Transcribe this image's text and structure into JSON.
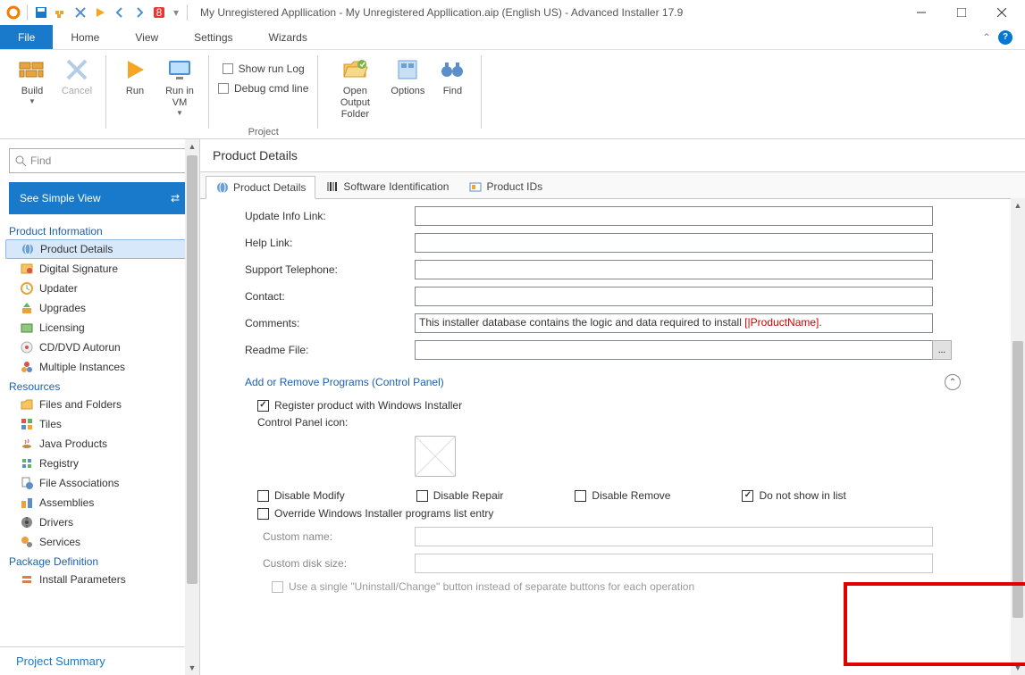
{
  "titlebar": {
    "title": "My Unregistered Appllication - My Unregistered Appllication.aip (English US) - Advanced Installer 17.9"
  },
  "menu": {
    "file": "File",
    "home": "Home",
    "view": "View",
    "settings": "Settings",
    "wizards": "Wizards"
  },
  "ribbon": {
    "build": "Build",
    "cancel": "Cancel",
    "run": "Run",
    "run_vm": "Run in VM",
    "show_run_log": "Show run Log",
    "debug_cmd": "Debug cmd line",
    "project": "Project",
    "open_output": "Open Output Folder",
    "options": "Options",
    "find": "Find"
  },
  "sidebar": {
    "find_placeholder": "Find",
    "simple_view": "See Simple View",
    "sections": {
      "product_info": "Product Information",
      "resources": "Resources",
      "package_def": "Package Definition"
    },
    "items": {
      "product_details": "Product Details",
      "digital_signature": "Digital Signature",
      "updater": "Updater",
      "upgrades": "Upgrades",
      "licensing": "Licensing",
      "cd_autorun": "CD/DVD Autorun",
      "multiple_instances": "Multiple Instances",
      "files_folders": "Files and Folders",
      "tiles": "Tiles",
      "java_products": "Java Products",
      "registry": "Registry",
      "file_assoc": "File Associations",
      "assemblies": "Assemblies",
      "drivers": "Drivers",
      "services": "Services",
      "install_params": "Install Parameters"
    },
    "summary": "Project Summary"
  },
  "content": {
    "title": "Product Details",
    "tabs": {
      "product_details": "Product Details",
      "software_id": "Software Identification",
      "product_ids": "Product IDs"
    },
    "fields": {
      "update_info": "Update Info Link:",
      "help_link": "Help Link:",
      "support_tel": "Support Telephone:",
      "contact": "Contact:",
      "comments": "Comments:",
      "comments_value_prefix": "This installer database contains the logic and data required to install ",
      "comments_value_token": "[|ProductName]",
      "comments_value_suffix": ".",
      "readme": "Readme File:"
    },
    "arp": {
      "title": "Add or Remove Programs (Control Panel)",
      "register": "Register product with Windows Installer",
      "icon_label": "Control Panel icon:",
      "disable_modify": "Disable Modify",
      "disable_repair": "Disable Repair",
      "disable_remove": "Disable Remove",
      "not_show": "Do not show in list",
      "override": "Override Windows Installer programs list entry",
      "custom_name": "Custom name:",
      "custom_size": "Custom disk size:",
      "single_button": "Use a single \"Uninstall/Change\" button instead of separate buttons for each operation"
    }
  }
}
